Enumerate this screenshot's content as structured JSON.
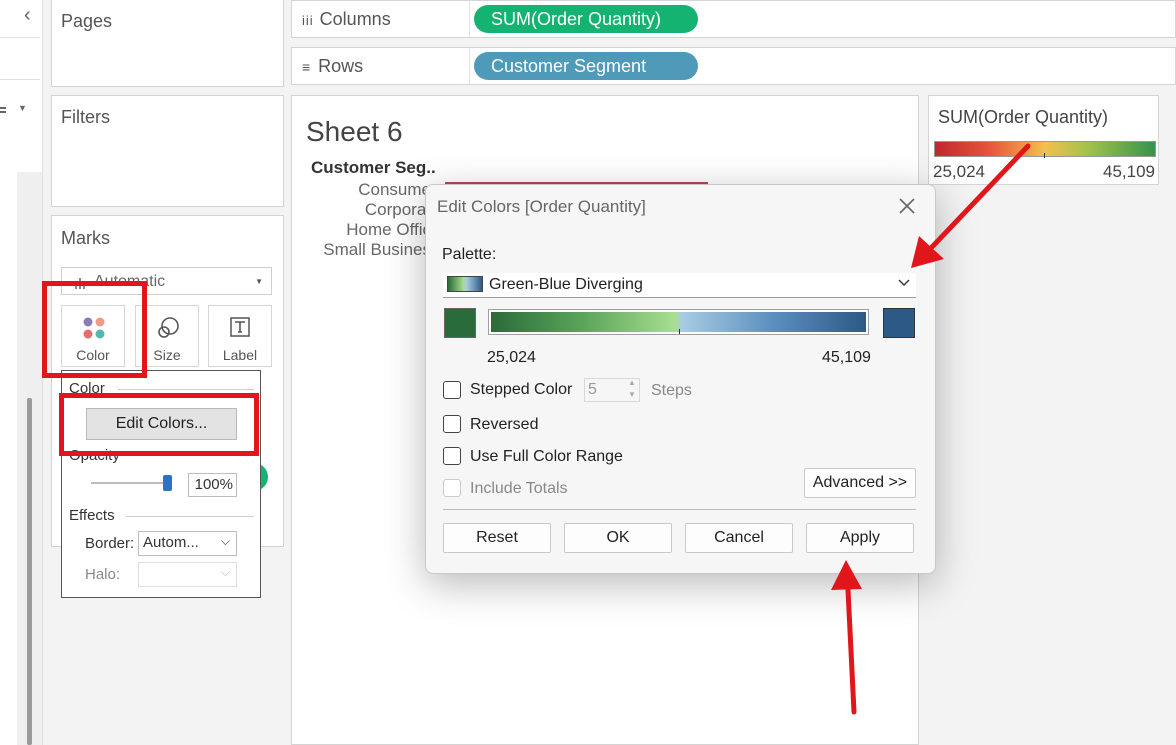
{
  "left_strip": {
    "collapse_glyph": "‹"
  },
  "pages": {
    "title": "Pages"
  },
  "filters": {
    "title": "Filters"
  },
  "marks": {
    "title": "Marks",
    "mark_type": "Automatic",
    "buttons": [
      {
        "label": "Color",
        "icon": "color-dots-icon"
      },
      {
        "label": "Size",
        "icon": "size-icon"
      },
      {
        "label": "Label",
        "icon": "text-label-icon"
      }
    ]
  },
  "color_popup": {
    "section_color": "Color",
    "edit_colors_label": "Edit Colors...",
    "opacity_label": "Opacity",
    "opacity_value": "100%",
    "opacity_level": 1.0,
    "effects_label": "Effects",
    "border_label": "Border:",
    "border_value": "Autom...",
    "halo_label": "Halo:",
    "halo_value": ""
  },
  "shelves": {
    "columns": {
      "label": "Columns",
      "icon": "columns-icon",
      "pill": "SUM(Order Quantity)",
      "pill_color": "#15b372"
    },
    "rows": {
      "label": "Rows",
      "icon": "rows-icon",
      "pill": "Customer Segment",
      "pill_color": "#4e9ab8"
    }
  },
  "sheet": {
    "title": "Sheet 6",
    "header": "Customer Seg..",
    "rows": [
      "Consume",
      "Corporat",
      "Home Offic",
      "Small Busines"
    ]
  },
  "legend": {
    "title": "SUM(Order Quantity)",
    "min": "25,024",
    "max": "45,109"
  },
  "dialog": {
    "title": "Edit Colors [Order Quantity]",
    "palette_label": "Palette:",
    "palette_value": "Green-Blue Diverging",
    "range_min": "25,024",
    "range_max": "45,109",
    "start_color": "#2a6b3a",
    "end_color": "#2c5986",
    "stepped_color_label": "Stepped Color",
    "steps_value": "5",
    "steps_label": "Steps",
    "reversed_label": "Reversed",
    "full_range_label": "Use Full Color Range",
    "include_totals_label": "Include Totals",
    "advanced_label": "Advanced >>",
    "reset_label": "Reset",
    "ok_label": "OK",
    "cancel_label": "Cancel",
    "apply_label": "Apply"
  }
}
